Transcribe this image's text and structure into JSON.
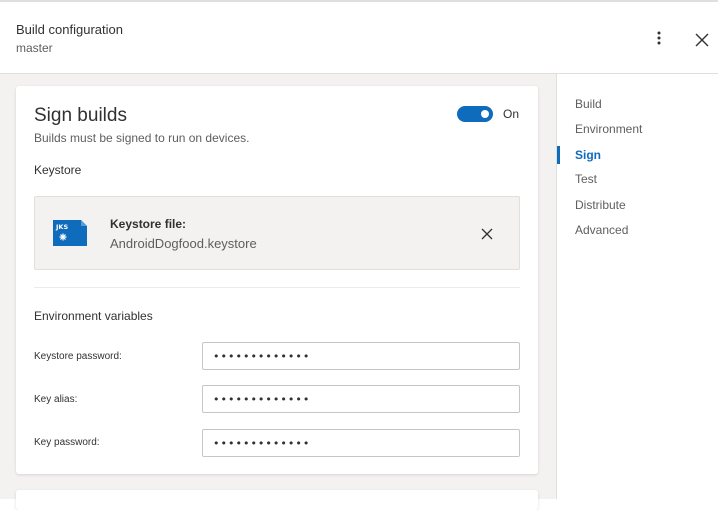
{
  "header": {
    "title": "Build configuration",
    "branch": "master"
  },
  "sign": {
    "title": "Sign builds",
    "description": "Builds must be signed to run on devices.",
    "toggle_state": "On",
    "keystore_section": "Keystore",
    "keystore": {
      "icon_text": "JKS",
      "label": "Keystore file:",
      "filename": "AndroidDogfood.keystore"
    },
    "env_section": "Environment variables",
    "fields": [
      {
        "label": "Keystore password:",
        "value": "•••••••••••••"
      },
      {
        "label": "Key alias:",
        "value": "•••••••••••••"
      },
      {
        "label": "Key password:",
        "value": "•••••••••••••"
      }
    ]
  },
  "nav": {
    "items": [
      {
        "label": "Build"
      },
      {
        "label": "Environment"
      },
      {
        "label": "Sign"
      },
      {
        "label": "Test"
      },
      {
        "label": "Distribute"
      },
      {
        "label": "Advanced"
      }
    ],
    "active": "Sign"
  },
  "colors": {
    "accent": "#0f6cbd",
    "background": "#f3f2f1"
  }
}
